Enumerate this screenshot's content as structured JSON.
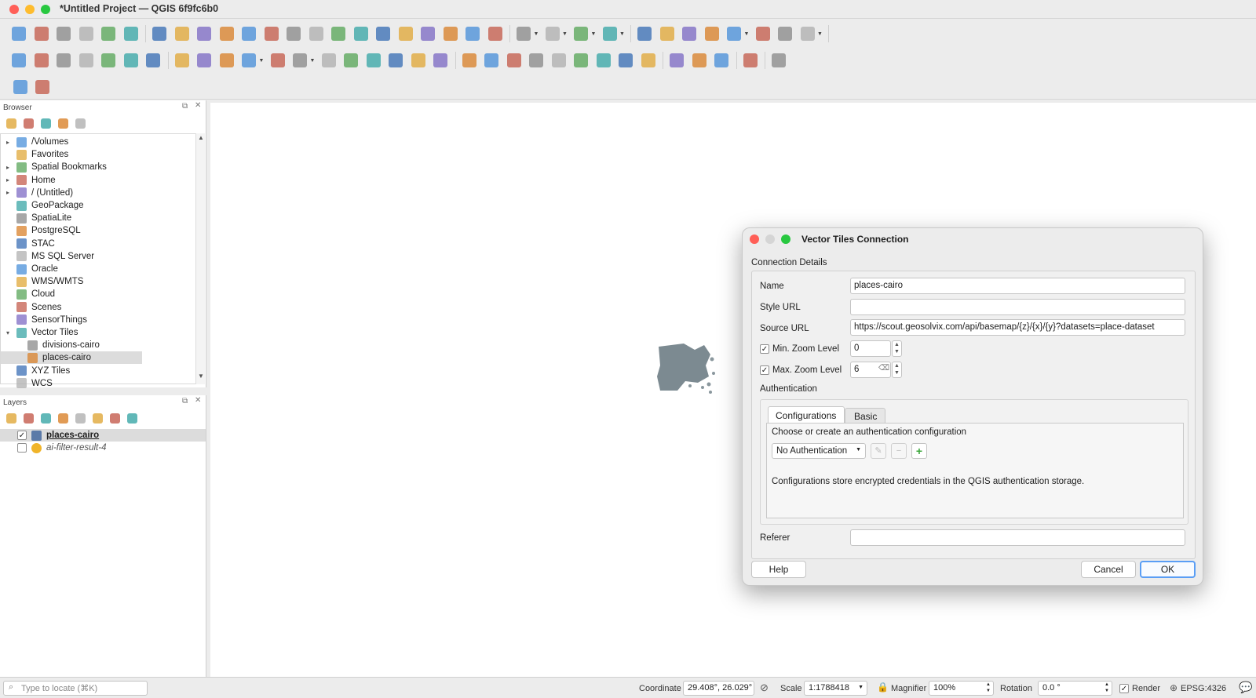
{
  "window": {
    "title": "*Untitled Project — QGIS 6f9fc6b0",
    "close_color": "#ff5f57",
    "minimize_color": "#febc2e",
    "maximize_color": "#28c840"
  },
  "toolbar1": {
    "icons": [
      "new-project-icon",
      "open-project-icon",
      "save-project-icon",
      "save-as-icon",
      "print-layout-icon",
      "style-manager-icon",
      "pan-icon",
      "pan-to-selection-icon",
      "zoom-in-icon",
      "zoom-out-icon",
      "zoom-full-icon",
      "zoom-to-selection-icon",
      "zoom-to-layer-icon",
      "zoom-native-icon",
      "zoom-last-icon",
      "zoom-next-icon",
      "new-map-view-icon",
      "new-3d-view-icon",
      "new-bookmark-icon",
      "show-bookmarks-icon",
      "temporal-controller-icon",
      "refresh-icon",
      "select-features-icon",
      "deselect-icon",
      "select-by-value-icon",
      "select-by-location-icon",
      "identify-icon",
      "attribute-table-icon",
      "processing-toolbox-icon",
      "statistics-icon",
      "field-calculator-icon",
      "measure-icon",
      "map-tips-icon",
      "locator-icon"
    ]
  },
  "toolbar2": {
    "icons": [
      "add-vector-icon",
      "add-geopackage-icon",
      "new-shapefile-icon",
      "new-temp-layer-icon",
      "new-spatialite-icon",
      "new-virtual-layer-icon",
      "new-mesh-icon",
      "toggle-editing-icon",
      "current-edits-icon",
      "save-edits-icon",
      "digitize-icon",
      "vertex-tool-icon",
      "move-feature-icon",
      "delete-selected-icon",
      "cut-features-icon",
      "copy-features-icon",
      "paste-features-icon",
      "undo-icon",
      "redo-icon",
      "label-toolbar-icon",
      "layer-labeling-icon",
      "highlight-pinned-icon",
      "toggle-labels-icon",
      "pin-label-icon",
      "show-hide-label-icon",
      "move-label-icon",
      "rotate-label-icon",
      "change-label-icon",
      "metasearch-icon",
      "geoscouter-icon",
      "web-search-icon",
      "python-console-icon",
      "help-icon"
    ]
  },
  "toolbar3": {
    "icons": [
      "plugin-search-icon",
      "plugin-paint-icon"
    ]
  },
  "browser": {
    "title": "Browser",
    "toolbar_icons": [
      "add-layer-icon",
      "refresh-icon",
      "filter-icon",
      "collapse-all-icon",
      "properties-icon"
    ],
    "items": [
      {
        "label": "/Volumes",
        "icon": "folder-icon",
        "expander": "▸",
        "indent": 0
      },
      {
        "label": "Favorites",
        "icon": "star-icon",
        "expander": "",
        "indent": 0
      },
      {
        "label": "Spatial Bookmarks",
        "icon": "bookmark-icon",
        "expander": "▸",
        "indent": 0
      },
      {
        "label": "Home",
        "icon": "home-icon",
        "expander": "▸",
        "indent": 0
      },
      {
        "label": "/ (Untitled)",
        "icon": "folder-icon",
        "expander": "▸",
        "indent": 0
      },
      {
        "label": "GeoPackage",
        "icon": "geopackage-icon",
        "expander": "",
        "indent": 0
      },
      {
        "label": "SpatiaLite",
        "icon": "spatialite-icon",
        "expander": "",
        "indent": 0
      },
      {
        "label": "PostgreSQL",
        "icon": "postgresql-icon",
        "expander": "",
        "indent": 0
      },
      {
        "label": "STAC",
        "icon": "stac-icon",
        "expander": "",
        "indent": 0
      },
      {
        "label": "MS SQL Server",
        "icon": "mssql-icon",
        "expander": "",
        "indent": 0
      },
      {
        "label": "Oracle",
        "icon": "oracle-icon",
        "expander": "",
        "indent": 0
      },
      {
        "label": "WMS/WMTS",
        "icon": "wms-icon",
        "expander": "",
        "indent": 0
      },
      {
        "label": "Cloud",
        "icon": "cloud-icon",
        "expander": "",
        "indent": 0
      },
      {
        "label": "Scenes",
        "icon": "scenes-icon",
        "expander": "",
        "indent": 0
      },
      {
        "label": "SensorThings",
        "icon": "sensorthings-icon",
        "expander": "",
        "indent": 0
      },
      {
        "label": "Vector Tiles",
        "icon": "vector-tiles-icon",
        "expander": "▾",
        "indent": 0
      },
      {
        "label": "divisions-cairo",
        "icon": "vector-tiles-icon",
        "expander": "",
        "indent": 1
      },
      {
        "label": "places-cairo",
        "icon": "vector-tiles-icon",
        "expander": "",
        "indent": 1,
        "selected": true
      },
      {
        "label": "XYZ Tiles",
        "icon": "xyz-tiles-icon",
        "expander": "",
        "indent": 0
      },
      {
        "label": "WCS",
        "icon": "wcs-icon",
        "expander": "",
        "indent": 0
      }
    ]
  },
  "layers": {
    "title": "Layers",
    "toolbar_icons": [
      "open-layer-styling-icon",
      "add-group-icon",
      "manage-map-themes-icon",
      "filter-legend-icon",
      "expression-filter-icon",
      "expand-all-icon",
      "collapse-all-icon",
      "remove-layer-icon"
    ],
    "items": [
      {
        "label": "places-cairo",
        "checked": true,
        "icon": "vector-tiles-icon",
        "bold": true
      },
      {
        "label": "ai-filter-result-4",
        "checked": false,
        "icon": "point-layer-icon",
        "italic": true
      }
    ]
  },
  "dialog": {
    "title": "Vector Tiles Connection",
    "section": "Connection Details",
    "name_label": "Name",
    "name_value": "places-cairo",
    "style_url_label": "Style URL",
    "style_url_value": "",
    "source_url_label": "Source URL",
    "source_url_value": "https://scout.geosolvix.com/api/basemap/{z}/{x}/{y}?datasets=place-dataset",
    "min_zoom_label": "Min. Zoom Level",
    "min_zoom_value": "0",
    "min_zoom_checked": "✓",
    "max_zoom_label": "Max. Zoom Level",
    "max_zoom_value": "6",
    "max_zoom_checked": "✓",
    "auth_label": "Authentication",
    "tab_configurations": "Configurations",
    "tab_basic": "Basic",
    "auth_prompt": "Choose or create an authentication configuration",
    "auth_select": "No Authentication",
    "auth_note": "Configurations store encrypted credentials in the QGIS authentication storage.",
    "referer_label": "Referer",
    "referer_value": "",
    "help": "Help",
    "cancel": "Cancel",
    "ok": "OK"
  },
  "statusbar": {
    "locator_placeholder": "Type to locate (⌘K)",
    "coordinate_label": "Coordinate",
    "coordinate_value": "29.408°, 26.029°",
    "scale_label": "Scale",
    "scale_value": "1:1788418",
    "magnifier_label": "Magnifier",
    "magnifier_value": "100%",
    "rotation_label": "Rotation",
    "rotation_value": "0.0 °",
    "render_label": "Render",
    "render_checked": "✓",
    "crs": "EPSG:4326"
  }
}
